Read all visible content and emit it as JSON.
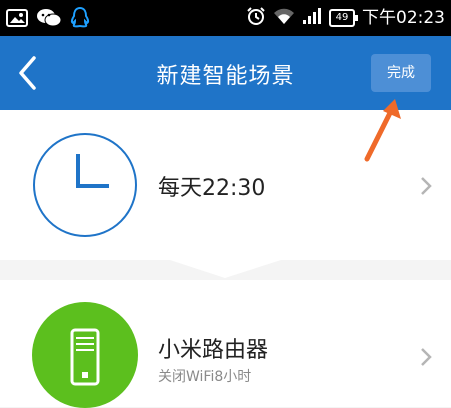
{
  "status_bar": {
    "battery_level": "49",
    "time": "下午02:23"
  },
  "header": {
    "title": "新建智能场景",
    "done_label": "完成"
  },
  "trigger": {
    "label": "每天22:30"
  },
  "action": {
    "device": "小米路由器",
    "description": "关闭WiFi8小时"
  },
  "colors": {
    "header_bg": "#1f74c8",
    "accent_green": "#5cbf1e",
    "clock_blue": "#1f74c8",
    "annotation_arrow": "#ef6a2a"
  },
  "icons": {
    "back": "chevron-left-icon",
    "trigger": "clock-icon",
    "action": "router-icon",
    "row_arrow": "chevron-right-icon"
  }
}
